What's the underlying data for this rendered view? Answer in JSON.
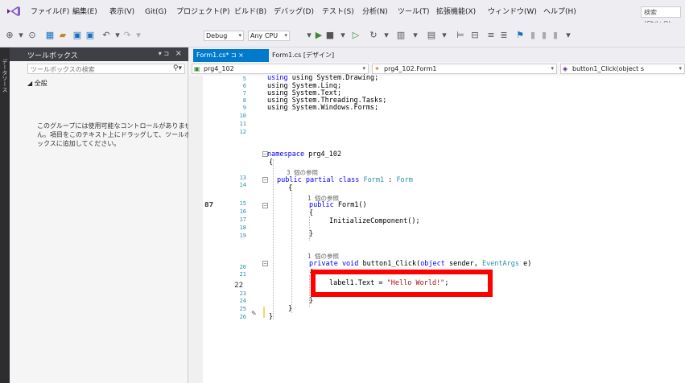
{
  "menubar": {
    "items": [
      "ファイル(F)",
      "編集(E)",
      "表示(V)",
      "Git(G)",
      "プロジェクト(P)",
      "ビルド(B)",
      "デバッグ(D)",
      "テスト(S)",
      "分析(N)",
      "ツール(T)",
      "拡張機能(X)",
      "ウィンドウ(W)",
      "ヘルプ(H)"
    ],
    "search_placeholder": "検索 (Ctrl+Q)"
  },
  "toolbar": {
    "config": "Debug",
    "platform": "Any CPU",
    "start_label": "開始"
  },
  "left_strip": {
    "label": "データソース"
  },
  "toolbox": {
    "title": "ツールボックス",
    "pin": "▾ ⊐ ×",
    "search_placeholder": "ツールボックスの検索",
    "general_group": "◢ 全般",
    "empty_message": "このグループには使用可能なコントロールがありません。項目をこのテキスト上にドラッグして、ツールボックスに追加してください。"
  },
  "editor": {
    "tabs": [
      {
        "label": "Form1.cs*  ⊐  ×"
      },
      {
        "label": "Form1.cs [デザイン]"
      }
    ],
    "nav": {
      "project": "prg4_102",
      "class": "prg4_102.Form1",
      "member": "button1_Click(object s"
    },
    "line_numbers": [
      "5",
      "6",
      "7",
      "8",
      "9",
      "10",
      "11",
      "12",
      "13",
      "14",
      "15",
      "16",
      "17",
      "18",
      "19",
      "20",
      "21",
      "22",
      "23",
      "24",
      "25",
      "26"
    ],
    "code": {
      "l5": "using System.Drawing;",
      "l6": "using System.Linq;",
      "l7": "using System.Text;",
      "l8": "using System.Threading.Tasks;",
      "l9": "using System.Windows.Forms;",
      "l11_kw": "namespace",
      "l11_rest": " prg4_102",
      "l12": "{",
      "ref3": "3 個の参照",
      "l13_kw": "public partial class",
      "l13_ty": "Form1",
      "l13_mid": " : ",
      "l13_ty2": "Form",
      "l14": "{",
      "ref1a": "1 個の参照",
      "l15_kw": "public",
      "l15_rest": " Form1()",
      "l16": "{",
      "l17": "InitializeComponent();",
      "l18": "}",
      "ref1b": "1 個の参照",
      "l20_kw": "private void",
      "l20_rest": " button1_Click(",
      "l20_kw2": "object",
      "l20_rest2": " sender, ",
      "l20_ty": "EventArgs",
      "l20_rest3": " e)",
      "l21": "{",
      "l22_a": "label1.Text = ",
      "l22_str": "\"Hello World!\"",
      "l22_end": ";",
      "l23": "}",
      "l24": "}",
      "l25": "}"
    }
  }
}
